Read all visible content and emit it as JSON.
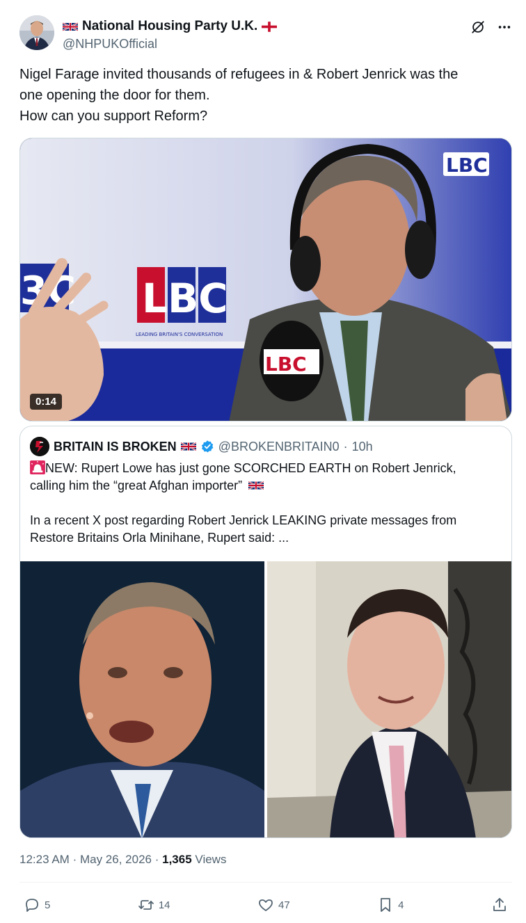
{
  "author": {
    "name": "National Housing Party U.K.",
    "handle": "@NHPUKOfficial"
  },
  "tweet": {
    "lines": [
      "Nigel Farage invited thousands of refugees in & Robert Jenrick was the",
      "one opening the door for them.",
      "How can you support Reform?"
    ]
  },
  "media": {
    "duration": "0:14",
    "brand_text": "LBC",
    "studio_caption": "LEADING BRITAIN'S CONVERSATION"
  },
  "quote": {
    "name": "BRITAIN IS BROKEN",
    "handle": "@BROKENBRITAIN0",
    "separator": "·",
    "time": "10h",
    "line1": "NEW: Rupert Lowe has just gone SCORCHED EARTH on Robert Jenrick,",
    "line2": "calling him the “great Afghan importer”",
    "line3": "In a recent X post regarding Robert Jenrick LEAKING private messages from",
    "line4": "Restore Britains Orla Minihane, Rupert said: ..."
  },
  "meta": {
    "time": "12:23 AM",
    "sep1": "·",
    "date": "May 26, 2026",
    "sep2": "·",
    "views_count": "1,365",
    "views_label": "Views"
  },
  "actions": {
    "replies": "5",
    "reposts": "14",
    "likes": "47",
    "bookmarks": "4"
  },
  "colors": {
    "text": "#0f1419",
    "muted": "#536471",
    "verified": "#1d9bf0",
    "border": "#cfd9de",
    "lbc_red": "#c8102e"
  },
  "icons": [
    "grok-icon",
    "more-icon",
    "reply-icon",
    "repost-icon",
    "like-icon",
    "bookmark-icon",
    "share-icon",
    "verified-icon",
    "uk-flag-icon",
    "england-flag-icon",
    "siren-icon"
  ]
}
